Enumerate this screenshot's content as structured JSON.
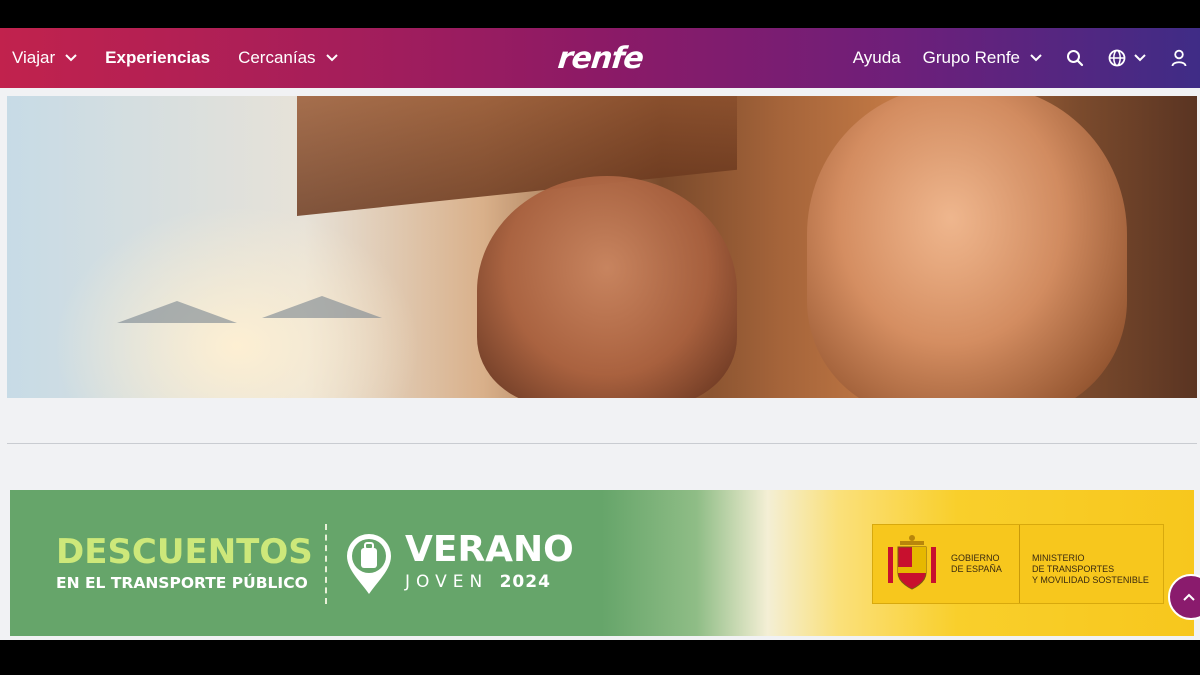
{
  "nav": {
    "left": [
      {
        "label": "Viajar",
        "has_dropdown": true
      },
      {
        "label": "Experiencias",
        "has_dropdown": false
      },
      {
        "label": "Cercanías",
        "has_dropdown": true
      }
    ],
    "logo": "renfe",
    "right": [
      {
        "label": "Ayuda",
        "has_dropdown": false
      },
      {
        "label": "Grupo Renfe",
        "has_dropdown": true
      }
    ],
    "icons": [
      "search-icon",
      "globe-icon",
      "user-icon"
    ]
  },
  "banner": {
    "headline": "DESCUENTOS",
    "subheadline": "EN EL TRANSPORTE PÚBLICO",
    "program_title": "VERANO",
    "program_sub": "JOVEN",
    "program_year": "2024",
    "gov_left": [
      "GOBIERNO",
      "DE ESPAÑA"
    ],
    "gov_right": [
      "MINISTERIO",
      "DE TRANSPORTES",
      "Y MOVILIDAD SOSTENIBLE"
    ]
  },
  "colors": {
    "nav_gradient_start": "#c1224d",
    "nav_gradient_end": "#3f2c86",
    "banner_green": "#66a56a",
    "banner_yellow": "#f7c71d",
    "accent_lime": "#cde87a"
  }
}
